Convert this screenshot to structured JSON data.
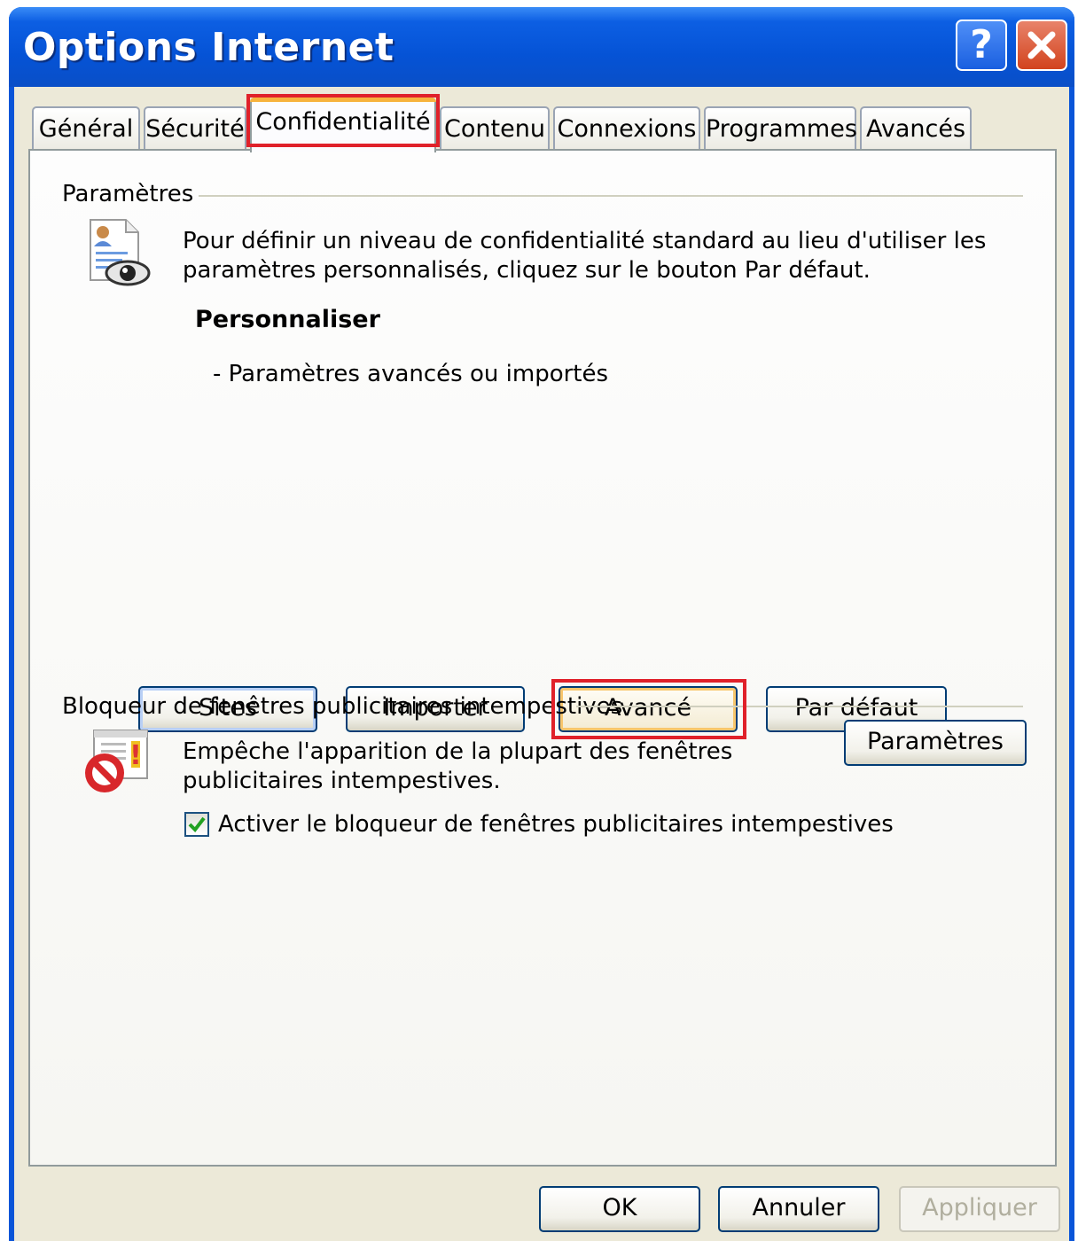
{
  "window": {
    "title": "Options Internet",
    "help_label": "?",
    "close_label": "✕"
  },
  "tabs": [
    {
      "label": "Général"
    },
    {
      "label": "Sécurité"
    },
    {
      "label": "Confidentialité",
      "selected": true
    },
    {
      "label": "Contenu"
    },
    {
      "label": "Connexions"
    },
    {
      "label": "Programmes"
    },
    {
      "label": "Avancés"
    }
  ],
  "privacy": {
    "group_label": "Paramètres",
    "description_line1": "Pour définir un niveau de confidentialité standard au lieu d'utiliser les",
    "description_line2": "paramètres personnalisés, cliquez sur le bouton Par défaut.",
    "level_title": "Personnaliser",
    "level_detail": "- Paramètres avancés ou importés",
    "buttons": {
      "sites": "Sites",
      "import": "Importer",
      "advanced": "Avancé",
      "default": "Par défaut"
    }
  },
  "popup_blocker": {
    "group_label": "Bloqueur de fenêtres publicitaires intempestives",
    "description_line1": "Empêche l'apparition de la plupart des fenêtres",
    "description_line2": "publicitaires intempestives.",
    "settings_button": "Paramètres",
    "checkbox_label": "Activer le bloqueur de fenêtres publicitaires intempestives",
    "checkbox_checked": true
  },
  "footer": {
    "ok": "OK",
    "cancel": "Annuler",
    "apply": "Appliquer"
  },
  "colors": {
    "titlebar": "#0553d6",
    "highlight": "#e0212a",
    "focus": "#f8c66c"
  }
}
